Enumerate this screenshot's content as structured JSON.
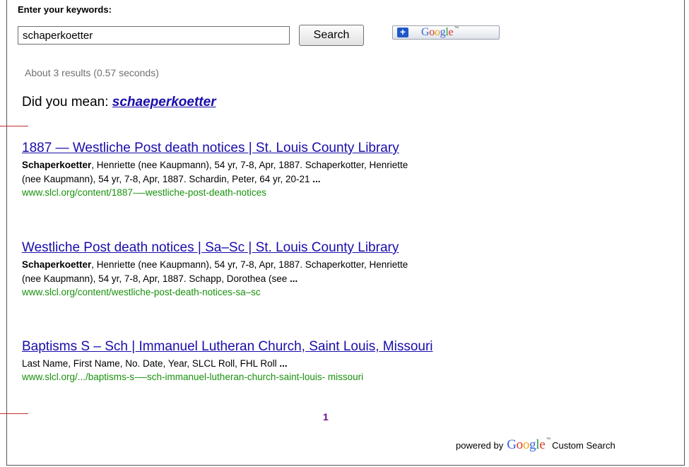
{
  "search": {
    "label": "Enter your keywords:",
    "value": "schaperkoetter",
    "button_label": "Search"
  },
  "add_google": {
    "plus": "+",
    "logo_letters": [
      "G",
      "o",
      "o",
      "g",
      "l",
      "e"
    ],
    "tm": "™"
  },
  "stats": "About 3 results (0.57 seconds)",
  "did_you_mean": {
    "prefix": "Did you mean: ",
    "suggestion": "schaeperkoetter"
  },
  "results": [
    {
      "title": "1887 — Westliche Post death notices | St. Louis County Library",
      "snippet_bold": "Schaperkoetter",
      "snippet_line1": ", Henriette (nee Kaupmann), 54 yr, 7-8, Apr, 1887. Schaperkotter, Henriette",
      "snippet_line2": "(nee Kaupmann), 54 yr, 7-8, Apr, 1887. Schardin, Peter, 64 yr, 20-21 ",
      "snippet_ellipsis": "...",
      "url": "www.slcl.org/content/1887-—westliche-post-death-notices"
    },
    {
      "title": "Westliche Post death notices | Sa–Sc | St. Louis County Library",
      "snippet_bold": "Schaperkoetter",
      "snippet_line1": ", Henriette (nee Kaupmann), 54 yr, 7-8, Apr, 1887. Schaperkotter, Henriette",
      "snippet_line2": "(nee Kaupmann), 54 yr, 7-8, Apr, 1887. Schapp, Dorothea (see ",
      "snippet_ellipsis": "...",
      "url": "www.slcl.org/content/westliche-post-death-notices-sa–sc"
    },
    {
      "title": "Baptisms S – Sch | Immanuel Lutheran Church, Saint Louis, Missouri",
      "snippet_line1": "Last Name, First Name, No. Date, Year, SLCL Roll, FHL Roll ",
      "snippet_ellipsis": "...",
      "url": "www.slcl.org/.../baptisms-s-—sch-immanuel-lutheran-church-saint-louis- missouri"
    }
  ],
  "pagination": {
    "current_page": "1"
  },
  "footer": {
    "powered_by": "powered by",
    "logo_letters": [
      "G",
      "o",
      "o",
      "g",
      "l",
      "e"
    ],
    "tm": "™",
    "custom_search": "Custom Search"
  },
  "colors": {
    "link": "#1a0dab",
    "url_green": "#18910c",
    "stats_gray": "#707070",
    "pager_purple": "#6a0d8a",
    "red_marker": "#c2322f"
  }
}
